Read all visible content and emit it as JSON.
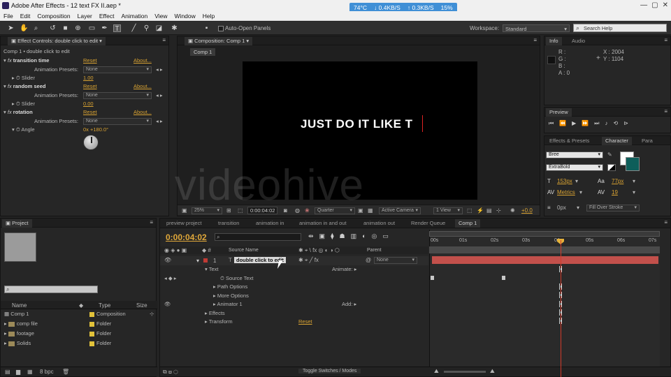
{
  "titlebar": {
    "title": "Adobe After Effects - 12 text FX II.aep *",
    "sysmon": {
      "temp": "74°C",
      "down": "0.4KB/S",
      "up": "0.3KB/S",
      "cpu": "15%"
    }
  },
  "menu": [
    "File",
    "Edit",
    "Composition",
    "Layer",
    "Effect",
    "Animation",
    "View",
    "Window",
    "Help"
  ],
  "toolbar": {
    "auto_open_label": "Auto-Open Panels",
    "workspace_label": "Workspace:",
    "workspace_value": "Standard",
    "search_placeholder": "Search Help"
  },
  "effect_controls": {
    "tab": "Effect Controls: double click to edit",
    "breadcrumb": "Comp 1 • double click to edit",
    "effects": [
      {
        "name": "transition time",
        "reset": "Reset",
        "about": "About...",
        "preset_label": "Animation Presets:",
        "preset": "None",
        "param": "Slider",
        "value": "1.00"
      },
      {
        "name": "random seed",
        "reset": "Reset",
        "about": "About...",
        "preset_label": "Animation Presets:",
        "preset": "None",
        "param": "Slider",
        "value": "0.00"
      },
      {
        "name": "rotation",
        "reset": "Reset",
        "about": "About...",
        "preset_label": "Animation Presets:",
        "preset": "None",
        "param": "Angle",
        "value": "0x +180.0°"
      }
    ]
  },
  "composition": {
    "tab": "Composition: Comp 1",
    "subtab": "Comp 1",
    "text": "JUST DO IT LIKE T",
    "watermark": "videohive",
    "zoom": "25%",
    "timecode": "0:00:04:02",
    "resolution": "Quarter",
    "camera": "Active Camera",
    "view": "1 View",
    "exposure": "+0.0"
  },
  "info": {
    "tabs": [
      "Info",
      "Audio"
    ],
    "r": "R :",
    "g": "G :",
    "b": "B :",
    "a": "A : 0",
    "x": "X : 2004",
    "y": "Y : 1104"
  },
  "preview": {
    "tab": "Preview"
  },
  "character": {
    "tabs": [
      "Effects & Presets",
      "Character",
      "Para"
    ],
    "font": "Bree",
    "style": "ExtraBold",
    "size": "153",
    "size_unit": "px",
    "leading": "77",
    "leading_unit": "px",
    "kerning": "Metrics",
    "tracking": "19",
    "stroke": "0",
    "stroke_unit": "px",
    "stroke_mode": "Fill Over Stroke",
    "fill_color": "#ffffff",
    "stroke_color": "#0e5e5a"
  },
  "project": {
    "tab": "Project",
    "columns": [
      "Name",
      "Type",
      "Size"
    ],
    "items": [
      {
        "name": "Comp 1",
        "type": "Composition"
      },
      {
        "name": "comp file",
        "type": "Folder"
      },
      {
        "name": "footage",
        "type": "Folder"
      },
      {
        "name": "Solids",
        "type": "Folder"
      }
    ],
    "bpc": "8 bpc"
  },
  "timeline": {
    "tabs": [
      "preview project",
      "transition",
      "animation in",
      "animation in and out",
      "animation out",
      "Render Queue",
      "Comp 1"
    ],
    "timecode": "0:00:04:02",
    "col_source": "Source Name",
    "col_parent": "Parent",
    "layer_num": "1",
    "layer_name": "double click to edit",
    "parent_value": "None",
    "props": [
      "Text",
      "Source Text",
      "Path Options",
      "More Options",
      "Animator 1",
      "Effects",
      "Transform"
    ],
    "animate_label": "Animate:",
    "add_label": "Add:",
    "reset_label": "Reset",
    "toggle_label": "Toggle Switches / Modes",
    "ruler": [
      "00s",
      "01s",
      "02s",
      "03s",
      "04s",
      "05s",
      "06s",
      "07s"
    ]
  }
}
